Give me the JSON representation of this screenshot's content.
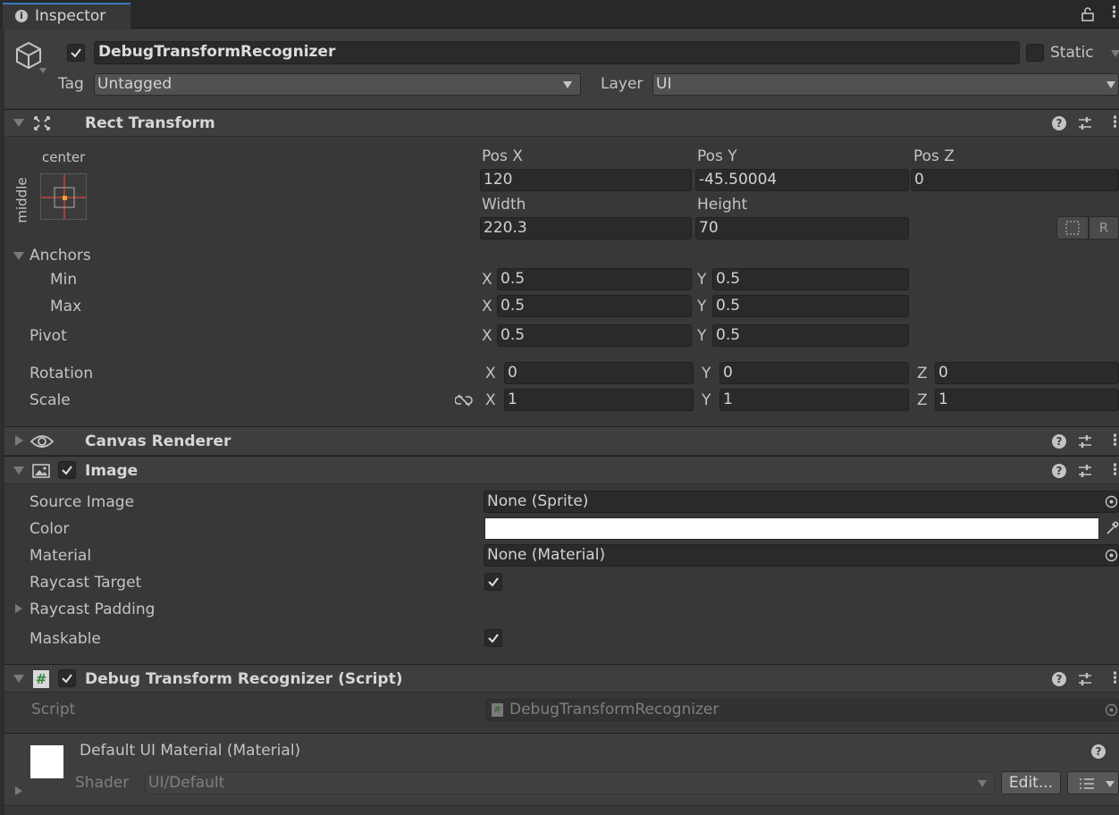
{
  "tab": {
    "title": "Inspector"
  },
  "object": {
    "name": "DebugTransformRecognizer",
    "static_label": "Static",
    "tag_label": "Tag",
    "tag_value": "Untagged",
    "layer_label": "Layer",
    "layer_value": "UI"
  },
  "rect_transform": {
    "title": "Rect Transform",
    "anchor_h": "center",
    "anchor_v": "middle",
    "posx_label": "Pos X",
    "posx": "120",
    "posy_label": "Pos Y",
    "posy": "-45.50004",
    "posz_label": "Pos Z",
    "posz": "0",
    "width_label": "Width",
    "width": "220.3",
    "height_label": "Height",
    "height": "70",
    "anchors_label": "Anchors",
    "min_label": "Min",
    "min_x": "0.5",
    "min_y": "0.5",
    "max_label": "Max",
    "max_x": "0.5",
    "max_y": "0.5",
    "pivot_label": "Pivot",
    "pivot_x": "0.5",
    "pivot_y": "0.5",
    "rotation_label": "Rotation",
    "rot_x": "0",
    "rot_y": "0",
    "rot_z": "0",
    "scale_label": "Scale",
    "scale_x": "1",
    "scale_y": "1",
    "scale_z": "1",
    "axis_x": "X",
    "axis_y": "Y",
    "axis_z": "Z"
  },
  "canvas_renderer": {
    "title": "Canvas Renderer"
  },
  "image": {
    "title": "Image",
    "source_label": "Source Image",
    "source_value": "None (Sprite)",
    "color_label": "Color",
    "color_value": "#ffffff",
    "material_label": "Material",
    "material_value": "None (Material)",
    "raycast_target_label": "Raycast Target",
    "raycast_padding_label": "Raycast Padding",
    "maskable_label": "Maskable"
  },
  "script_component": {
    "title": "Debug Transform Recognizer (Script)",
    "script_label": "Script",
    "script_value": "DebugTransformRecognizer"
  },
  "material": {
    "title": "Default UI Material (Material)",
    "shader_label": "Shader",
    "shader_value": "UI/Default",
    "edit_label": "Edit..."
  },
  "colors": {
    "bg": "#383838",
    "header": "#3e3e3e",
    "field": "#2a2a2a",
    "accent": "#f0a030"
  }
}
